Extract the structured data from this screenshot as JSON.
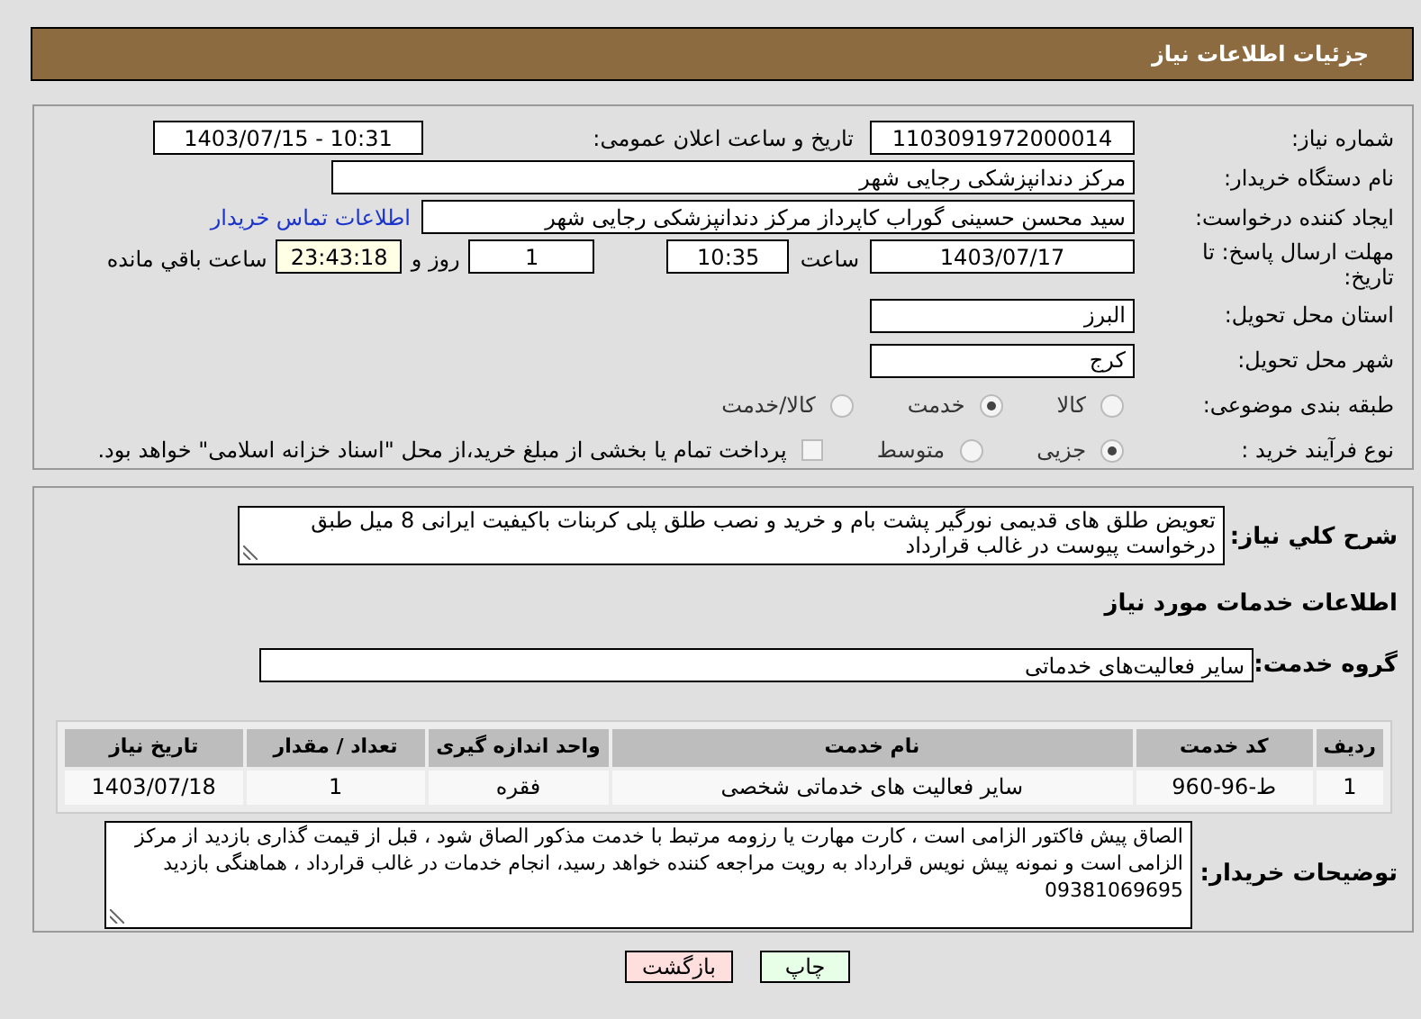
{
  "header": {
    "title": "جزئیات اطلاعات نیاز"
  },
  "need_number": {
    "label": "شماره نیاز:",
    "value": "1103091972000014"
  },
  "announce": {
    "label": "تاریخ و ساعت اعلان عمومی:",
    "value": "1403/07/15 - 10:31"
  },
  "buyer_org": {
    "label": "نام دستگاه خریدار:",
    "value": "مرکز دندانپزشکی رجایی شهر"
  },
  "creator": {
    "label": "ایجاد کننده درخواست:",
    "value": "سید محسن  حسینی گوراب کاپرداز مرکز دندانپزشکی رجایی شهر",
    "link": "اطلاعات تماس خریدار"
  },
  "deadline": {
    "label": "مهلت ارسال پاسخ: تا تاریخ:",
    "date": "1403/07/17",
    "time_label": "ساعت",
    "time": "10:35",
    "days": "1",
    "days_label": "روز و",
    "remaining": "23:43:18",
    "remaining_label": "ساعت باقي مانده"
  },
  "province": {
    "label": "استان محل تحویل:",
    "value": "البرز"
  },
  "city": {
    "label": "شهر محل تحویل:",
    "value": "کرج"
  },
  "category": {
    "label": "طبقه بندی موضوعی:",
    "options": [
      {
        "label": "کالا",
        "selected": false
      },
      {
        "label": "خدمت",
        "selected": true
      },
      {
        "label": "کالا/خدمت",
        "selected": false
      }
    ]
  },
  "process": {
    "label": "نوع فرآیند خرید :",
    "options": [
      {
        "label": "جزیی",
        "selected": true
      },
      {
        "label": "متوسط",
        "selected": false
      }
    ],
    "payment_checkbox": {
      "checked": false,
      "text": "پرداخت تمام یا بخشی از مبلغ خرید،از محل \"اسناد خزانه اسلامی\" خواهد بود."
    }
  },
  "description": {
    "label": "شرح کلي نياز:",
    "text": "تعویض طلق های قدیمی نورگیر پشت بام و خرید و نصب طلق پلی کربنات باکیفیت ایرانی 8 میل طبق درخواست پیوست در غالب قرارداد"
  },
  "services_title": "اطلاعات خدمات مورد نیاز",
  "service_group": {
    "label": "گروه خدمت:",
    "value": "سایر فعالیت‌های خدماتی"
  },
  "table": {
    "columns": [
      "ردیف",
      "کد خدمت",
      "نام خدمت",
      "واحد اندازه گیری",
      "تعداد / مقدار",
      "تاریخ نیاز"
    ],
    "rows": [
      [
        "1",
        "ط-96-960",
        "سایر فعالیت های خدماتی شخصی",
        "فقره",
        "1",
        "1403/07/18"
      ]
    ]
  },
  "buyer_notes": {
    "label": "توضیحات خریدار:",
    "text": "الصاق پیش فاکتور الزامی است ، کارت مهارت یا رزومه مرتبط با خدمت مذکور الصاق شود ، قبل از قیمت گذاری بازدید از مرکز الزامی است و نمونه پیش نویس قرارداد به رویت مراجعه کننده خواهد رسید، انجام خدمات در غالب قرارداد ، هماهنگی بازدید 09381069695"
  },
  "buttons": [
    {
      "label": "چاپ",
      "kind": "print"
    },
    {
      "label": "بازگشت",
      "kind": "back"
    }
  ]
}
